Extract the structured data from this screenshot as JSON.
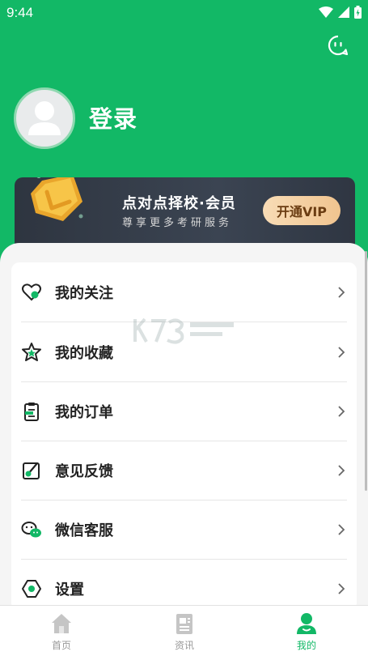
{
  "status_bar": {
    "time": "9:44"
  },
  "profile": {
    "login_label": "登录"
  },
  "vip": {
    "title": "点对点择校·会员",
    "subtitle": "尊享更多考研服务",
    "button_label": "开通VIP"
  },
  "menu": {
    "items": [
      {
        "label": "我的关注",
        "icon": "heart-icon"
      },
      {
        "label": "我的收藏",
        "icon": "star-icon"
      },
      {
        "label": "我的订单",
        "icon": "clipboard-icon"
      },
      {
        "label": "意见反馈",
        "icon": "edit-icon"
      },
      {
        "label": "微信客服",
        "icon": "wechat-icon"
      },
      {
        "label": "设置",
        "icon": "settings-icon"
      }
    ]
  },
  "tabbar": {
    "tabs": [
      {
        "label": "首页",
        "icon": "home-icon"
      },
      {
        "label": "资讯",
        "icon": "news-icon"
      },
      {
        "label": "我的",
        "icon": "profile-icon",
        "active": true
      }
    ]
  },
  "colors": {
    "brand": "#12b866",
    "vip_card": "#353c48",
    "vip_button": "#f3cfa0",
    "inactive_tab": "#999999"
  }
}
